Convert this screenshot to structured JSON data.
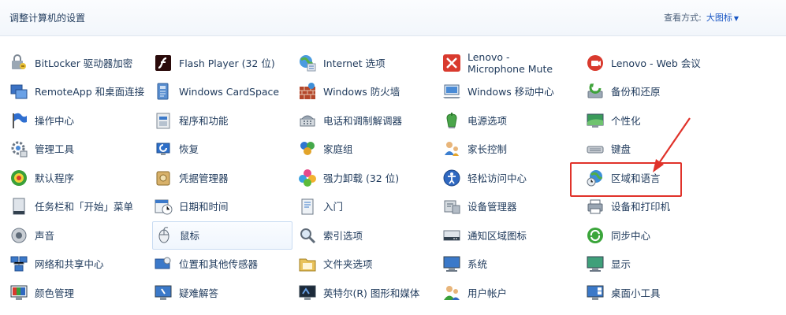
{
  "header": {
    "title": "调整计算机的设置",
    "view_label": "查看方式:",
    "view_mode": "大图标"
  },
  "items": [
    {
      "label": "BitLocker 驱动器加密",
      "icon": "bitlocker-icon"
    },
    {
      "label": "Flash Player (32 位)",
      "icon": "flash-icon"
    },
    {
      "label": "Internet 选项",
      "icon": "internet-options-icon"
    },
    {
      "label": "Lenovo - Microphone Mute",
      "icon": "microphone-mute-icon"
    },
    {
      "label": "Lenovo - Web 会议",
      "icon": "web-conference-icon"
    },
    {
      "label": "RemoteApp 和桌面连接",
      "icon": "remoteapp-icon"
    },
    {
      "label": "Windows CardSpace",
      "icon": "cardspace-icon"
    },
    {
      "label": "Windows 防火墙",
      "icon": "firewall-icon"
    },
    {
      "label": "Windows 移动中心",
      "icon": "mobility-center-icon"
    },
    {
      "label": "备份和还原",
      "icon": "backup-icon"
    },
    {
      "label": "操作中心",
      "icon": "action-center-flag-icon"
    },
    {
      "label": "程序和功能",
      "icon": "programs-icon"
    },
    {
      "label": "电话和调制解调器",
      "icon": "phone-modem-icon"
    },
    {
      "label": "电源选项",
      "icon": "power-icon"
    },
    {
      "label": "个性化",
      "icon": "personalization-icon"
    },
    {
      "label": "管理工具",
      "icon": "admin-tools-icon"
    },
    {
      "label": "恢复",
      "icon": "recovery-icon"
    },
    {
      "label": "家庭组",
      "icon": "homegroup-icon"
    },
    {
      "label": "家长控制",
      "icon": "parental-control-icon"
    },
    {
      "label": "键盘",
      "icon": "keyboard-icon"
    },
    {
      "label": "默认程序",
      "icon": "default-programs-icon"
    },
    {
      "label": "凭据管理器",
      "icon": "credential-manager-icon"
    },
    {
      "label": "强力卸载 (32 位)",
      "icon": "uninstaller-icon"
    },
    {
      "label": "轻松访问中心",
      "icon": "ease-of-access-icon"
    },
    {
      "label": "区域和语言",
      "icon": "region-language-icon"
    },
    {
      "label": "任务栏和「开始」菜单",
      "icon": "taskbar-icon"
    },
    {
      "label": "日期和时间",
      "icon": "date-time-icon"
    },
    {
      "label": "入门",
      "icon": "getting-started-icon"
    },
    {
      "label": "设备管理器",
      "icon": "device-manager-icon"
    },
    {
      "label": "设备和打印机",
      "icon": "printer-icon"
    },
    {
      "label": "声音",
      "icon": "sound-icon"
    },
    {
      "label": "鼠标",
      "icon": "mouse-icon"
    },
    {
      "label": "索引选项",
      "icon": "indexing-icon"
    },
    {
      "label": "通知区域图标",
      "icon": "notification-area-icon"
    },
    {
      "label": "同步中心",
      "icon": "sync-center-icon"
    },
    {
      "label": "网络和共享中心",
      "icon": "network-icon"
    },
    {
      "label": "位置和其他传感器",
      "icon": "location-sensor-icon"
    },
    {
      "label": "文件夹选项",
      "icon": "folder-options-icon"
    },
    {
      "label": "系统",
      "icon": "system-icon"
    },
    {
      "label": "显示",
      "icon": "display-icon"
    },
    {
      "label": "颜色管理",
      "icon": "color-management-icon"
    },
    {
      "label": "疑难解答",
      "icon": "troubleshooting-icon"
    },
    {
      "label": "英特尔(R) 图形和媒体",
      "icon": "intel-graphics-icon"
    },
    {
      "label": "用户帐户",
      "icon": "user-accounts-icon"
    },
    {
      "label": "桌面小工具",
      "icon": "gadgets-icon"
    }
  ],
  "colors": {
    "link_text": "#1e395b",
    "accent_blue": "#1a57c4",
    "annotation_red": "#e0322a",
    "hover_border": "#c9dcf2"
  }
}
